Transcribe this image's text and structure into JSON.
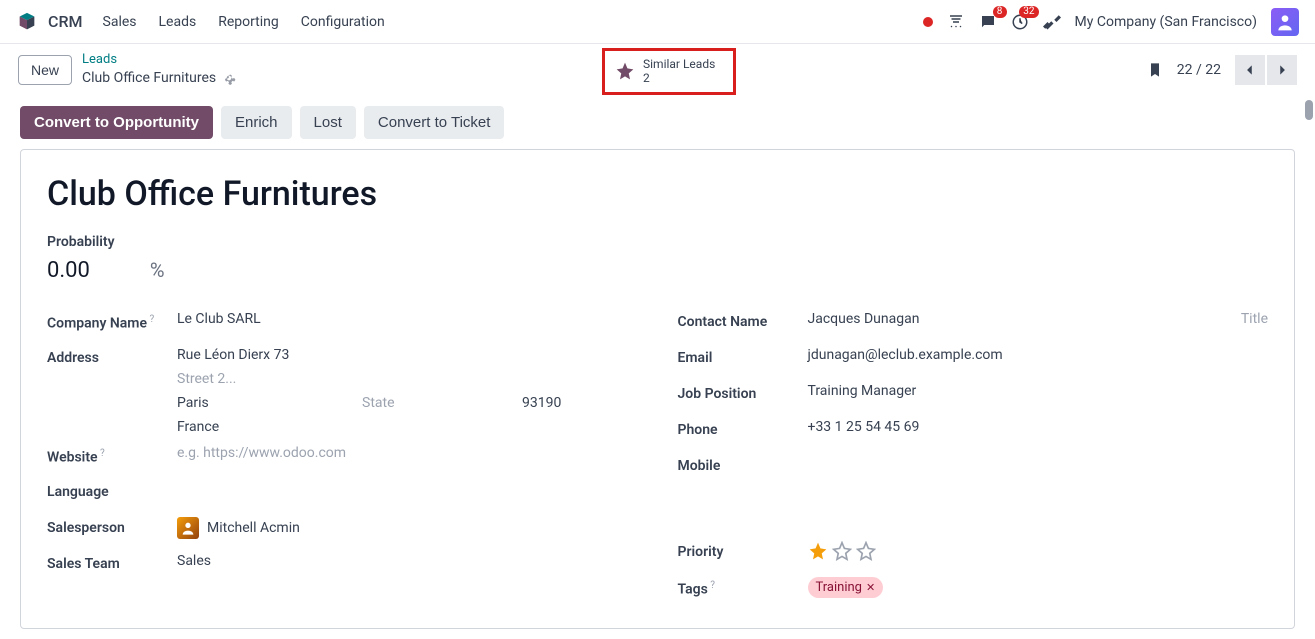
{
  "topbar": {
    "app_name": "CRM",
    "menu": [
      "Sales",
      "Leads",
      "Reporting",
      "Configuration"
    ],
    "msg_badge": "8",
    "activity_badge": "32",
    "company": "My Company (San Francisco)"
  },
  "subheader": {
    "new_label": "New",
    "breadcrumb_parent": "Leads",
    "breadcrumb_current": "Club Office Furnitures",
    "similar_label": "Similar Leads",
    "similar_count": "2",
    "pager": "22 / 22"
  },
  "actions": {
    "convert_opportunity": "Convert to Opportunity",
    "enrich": "Enrich",
    "lost": "Lost",
    "convert_ticket": "Convert to Ticket"
  },
  "record": {
    "title": "Club Office Furnitures",
    "probability_label": "Probability",
    "probability_value": "0.00",
    "percent": "%"
  },
  "left": {
    "company_name_label": "Company Name",
    "company_name_value": "Le Club SARL",
    "address_label": "Address",
    "street1": "Rue Léon Dierx 73",
    "street2_placeholder": "Street 2...",
    "city": "Paris",
    "state_placeholder": "State",
    "zip": "93190",
    "country": "France",
    "website_label": "Website",
    "website_placeholder": "e.g. https://www.odoo.com",
    "language_label": "Language",
    "salesperson_label": "Salesperson",
    "salesperson_value": "Mitchell Acmin",
    "sales_team_label": "Sales Team",
    "sales_team_value": "Sales"
  },
  "right": {
    "contact_name_label": "Contact Name",
    "contact_name_value": "Jacques Dunagan",
    "title_placeholder": "Title",
    "email_label": "Email",
    "email_value": "jdunagan@leclub.example.com",
    "job_label": "Job Position",
    "job_value": "Training Manager",
    "phone_label": "Phone",
    "phone_value": "+33 1 25 54 45 69",
    "mobile_label": "Mobile",
    "priority_label": "Priority",
    "tags_label": "Tags",
    "tag_value": "Training"
  }
}
